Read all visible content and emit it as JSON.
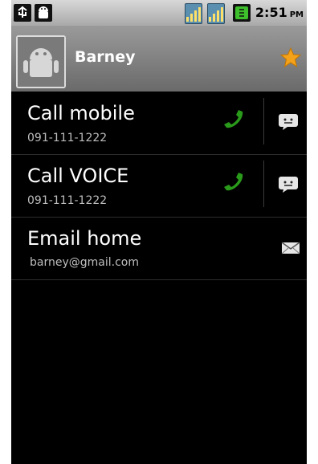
{
  "status": {
    "time": "2:51",
    "ampm": "PM",
    "icons": [
      "usb-icon",
      "android-icon",
      "signal-icon",
      "signal-icon",
      "battery-icon"
    ]
  },
  "contact": {
    "name": "Barney",
    "starred": true
  },
  "actions": [
    {
      "label": "Call mobile",
      "value": "091-111-1222",
      "type": "call",
      "icons": [
        "phone-icon",
        "message-icon"
      ]
    },
    {
      "label": "Call VOICE",
      "value": "091-111-1222",
      "type": "call",
      "icons": [
        "phone-icon",
        "message-icon"
      ]
    },
    {
      "label": "Email home",
      "value": "barney@gmail.com",
      "type": "email",
      "icons": [
        "envelope-icon"
      ]
    }
  ],
  "colors": {
    "screen_bg": "#000000",
    "phone_green": "#2a9a1b",
    "star_orange": "#f4a21a"
  }
}
